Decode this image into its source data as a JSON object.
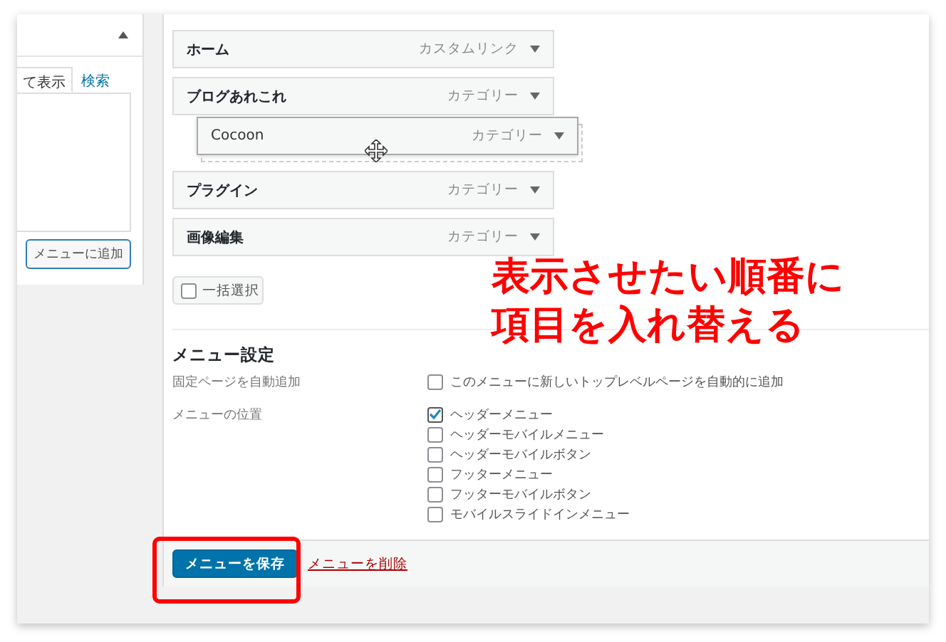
{
  "left_panel": {
    "tabs": [
      {
        "label": "て表示",
        "selected": true
      },
      {
        "label": "検索",
        "selected": false
      }
    ],
    "add_button": "メニューに追加"
  },
  "menu_items": [
    {
      "title": "ホーム",
      "type": "カスタムリンク"
    },
    {
      "title": "ブログあれこれ",
      "type": "カテゴリー"
    },
    {
      "title": "プラグイン",
      "type": "カテゴリー"
    },
    {
      "title": "画像編集",
      "type": "カテゴリー"
    }
  ],
  "dragged_item": {
    "title": "Cocoon",
    "type": "カテゴリー"
  },
  "bulk_select": {
    "label": "一括選択",
    "checked": false
  },
  "settings": {
    "heading": "メニュー設定",
    "rows": [
      {
        "label": "固定ページを自動追加",
        "options": [
          {
            "label": "このメニューに新しいトップレベルページを自動的に追加",
            "checked": false
          }
        ]
      },
      {
        "label": "メニューの位置",
        "options": [
          {
            "label": "ヘッダーメニュー",
            "checked": true
          },
          {
            "label": "ヘッダーモバイルメニュー",
            "checked": false
          },
          {
            "label": "ヘッダーモバイルボタン",
            "checked": false
          },
          {
            "label": "フッターメニュー",
            "checked": false
          },
          {
            "label": "フッターモバイルボタン",
            "checked": false
          },
          {
            "label": "モバイルスライドインメニュー",
            "checked": false
          }
        ]
      }
    ]
  },
  "footer": {
    "save_button": "メニューを保存",
    "delete_link": "メニューを削除"
  },
  "annotation": {
    "lines": [
      "表示させたい順番に",
      "項目を入れ替える"
    ]
  }
}
